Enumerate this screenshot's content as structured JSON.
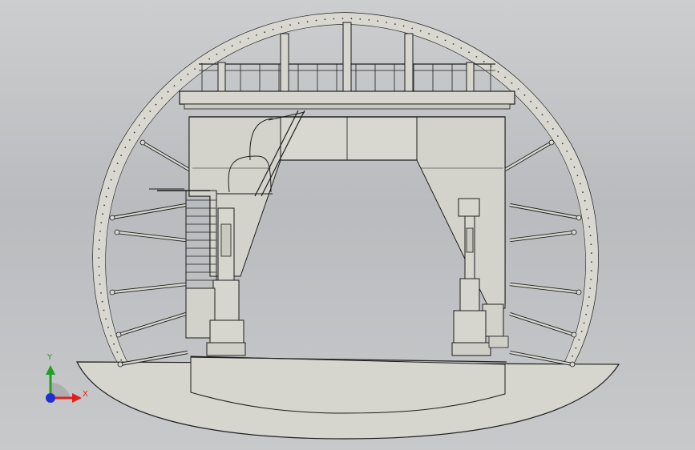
{
  "view": {
    "background_color": "#c4c5c7",
    "model_fill": "#d6d6ce",
    "model_fill_dark": "#c9c9c0",
    "edge_color": "#1d1d1d"
  },
  "triad": {
    "x_label": "X",
    "y_label": "Y",
    "x_color": "#e02020",
    "y_color": "#20a020",
    "z_color": "#2030d0"
  }
}
